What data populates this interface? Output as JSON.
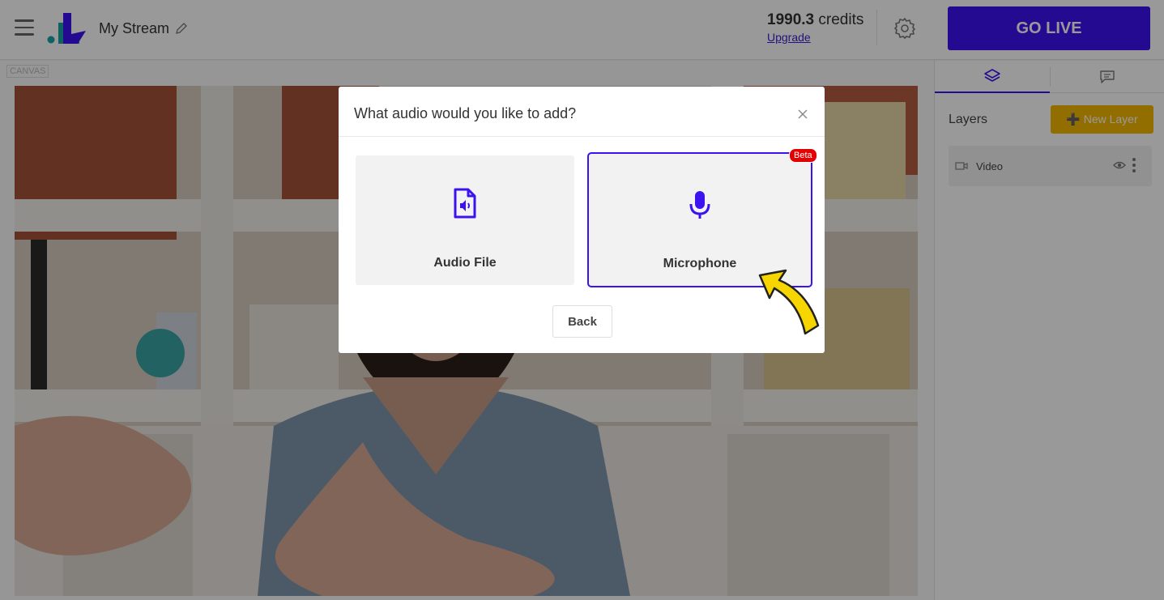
{
  "header": {
    "stream_title": "My Stream",
    "credits_value": "1990.3",
    "credits_unit": "credits",
    "upgrade_label": "Upgrade",
    "go_live_label": "GO LIVE"
  },
  "canvas": {
    "tag": "CANVAS"
  },
  "panel": {
    "tabs": [
      {
        "icon": "layers-icon",
        "active": true
      },
      {
        "icon": "chat-icon",
        "active": false
      }
    ],
    "layers_title": "Layers",
    "new_layer_label": "New Layer",
    "layers": [
      {
        "name": "Video",
        "icon": "camera-icon"
      }
    ]
  },
  "modal": {
    "title": "What audio would you like to add?",
    "options": [
      {
        "label": "Audio File",
        "icon": "audio-file-icon"
      },
      {
        "label": "Microphone",
        "icon": "microphone-icon",
        "badge": "Beta",
        "selected": true
      }
    ],
    "back_label": "Back"
  },
  "colors": {
    "accent": "#3d12f0",
    "new_layer": "#f4b800",
    "beta_badge": "#e40000",
    "arrow": "#f7d500"
  }
}
